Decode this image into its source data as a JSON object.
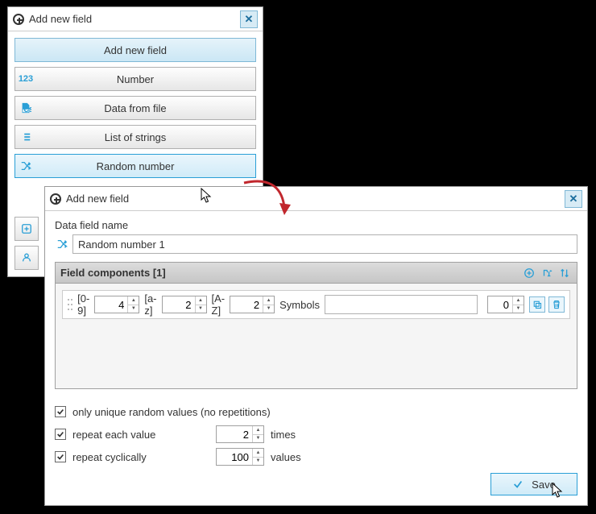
{
  "dlg1": {
    "title": "Add new field",
    "options": {
      "header": "Add new field",
      "number": "Number",
      "data_from_file": "Data from file",
      "list_of_strings": "List of strings",
      "random_number": "Random number"
    }
  },
  "dlg2": {
    "title": "Add new field",
    "name_label": "Data field name",
    "name_value": "Random number 1",
    "components_label": "Field components  [1]",
    "row": {
      "r1_label": "[0-9]",
      "r1_value": "4",
      "r2_label": "[a-z]",
      "r2_value": "2",
      "r3_label": "[A-Z]",
      "r3_value": "2",
      "symbols_label": "Symbols",
      "symbols_value": "",
      "extra_value": "0"
    },
    "opts": {
      "unique": "only unique random values (no repetitions)",
      "repeat_each": "repeat each value",
      "repeat_each_value": "2",
      "repeat_each_after": "times",
      "repeat_cyc": "repeat cyclically",
      "repeat_cyc_value": "100",
      "repeat_cyc_after": "values"
    },
    "save_label": "Save"
  }
}
